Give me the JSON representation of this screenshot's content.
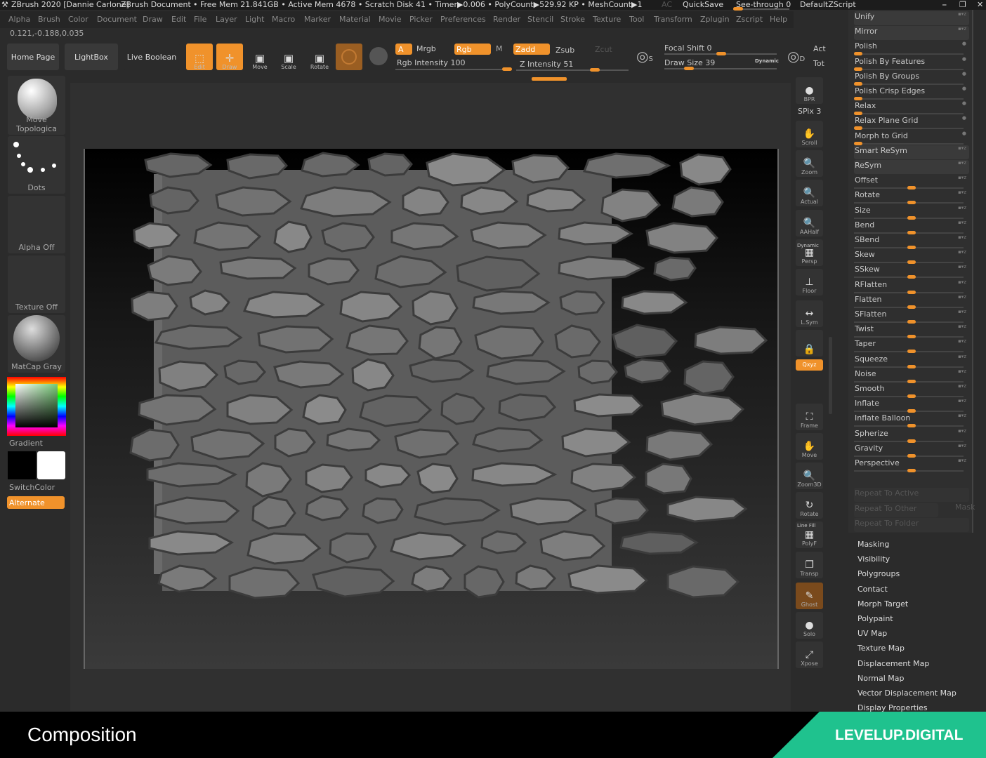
{
  "titlebar": {
    "app": "ZBrush 2020 [Dannie Carlone]",
    "doc": "ZBrush Document",
    "stats": "• Free Mem 21.841GB • Active Mem 4678 • Scratch Disk 41 • Timer▶0.006 • PolyCount▶529.92 KP • MeshCount▶1",
    "ac": "AC",
    "quicksave": "QuickSave",
    "seethrough": "See-through  0",
    "script": "DefaultZScript"
  },
  "menu": [
    "Alpha",
    "Brush",
    "Color",
    "Document",
    "Draw",
    "Edit",
    "File",
    "Layer",
    "Light",
    "Macro",
    "Marker",
    "Material",
    "Movie",
    "Picker",
    "Preferences",
    "Render",
    "Stencil",
    "Stroke",
    "Texture",
    "Tool",
    "Transform",
    "Zplugin",
    "Zscript",
    "Help"
  ],
  "coords": "0.121,-0.188,0.035",
  "toolbar": {
    "home": "Home Page",
    "lightbox": "LightBox",
    "liveboolean": "Live Boolean",
    "edit": "Edit",
    "draw": "Draw",
    "move": "Move",
    "scale": "Scale",
    "rotate": "Rotate",
    "a": "A",
    "mrgb": "Mrgb",
    "rgb": "Rgb",
    "m": "M",
    "zadd": "Zadd",
    "zsub": "Zsub",
    "zcut": "Zcut",
    "rgb_intensity": "Rgb Intensity 100",
    "z_intensity": "Z Intensity 51",
    "focal_shift": "Focal Shift 0",
    "draw_size": "Draw Size 39",
    "dynamic": "Dynamic",
    "act": "Act",
    "tot": "Tot",
    "s": "S",
    "d": "D"
  },
  "left_shelf": {
    "brush": "Move Topologica",
    "stroke": "Dots",
    "alpha": "Alpha Off",
    "texture": "Texture Off",
    "material": "MatCap Gray",
    "gradient": "Gradient",
    "switchcolor": "SwitchColor",
    "alternate": "Alternate"
  },
  "right_shelf": [
    {
      "label": "BPR",
      "icon": "sphere-icon"
    },
    {
      "label": "Scroll",
      "icon": "hand-icon"
    },
    {
      "label": "Zoom",
      "icon": "magnifier-icon"
    },
    {
      "label": "Actual",
      "icon": "magnifier-icon"
    },
    {
      "label": "AAHalf",
      "icon": "magnifier-icon"
    },
    {
      "label": "Persp",
      "icon": "grid-icon"
    },
    {
      "label": "Floor",
      "icon": "floor-icon"
    },
    {
      "label": "L.Sym",
      "icon": "symmetry-icon"
    },
    {
      "label": "",
      "icon": "lock-icon"
    },
    {
      "label": "Qxyz",
      "icon": "axis-icon"
    },
    {
      "label": "Frame",
      "icon": "frame-icon"
    },
    {
      "label": "Move",
      "icon": "hand-icon"
    },
    {
      "label": "Zoom3D",
      "icon": "magnifier-icon"
    },
    {
      "label": "Rotate",
      "icon": "rotate-icon"
    },
    {
      "label": "PolyF",
      "icon": "grid-icon"
    },
    {
      "label": "Transp",
      "icon": "layers-icon"
    },
    {
      "label": "Ghost",
      "icon": "ghost-icon"
    },
    {
      "label": "Solo",
      "icon": "solo-icon"
    },
    {
      "label": "Xpose",
      "icon": "expand-icon"
    }
  ],
  "spix": "SPix 3",
  "persp_dynamic": "Dynamic",
  "linefill": "Line Fill",
  "deformation": [
    {
      "label": "Unify",
      "kind": "box"
    },
    {
      "label": "Mirror",
      "kind": "box"
    },
    {
      "label": "Polish",
      "kind": "small",
      "value": 0
    },
    {
      "label": "Polish By Features",
      "kind": "small",
      "value": 0
    },
    {
      "label": "Polish By Groups",
      "kind": "small",
      "value": 0
    },
    {
      "label": "Polish Crisp Edges",
      "kind": "small",
      "value": 0
    },
    {
      "label": "Relax",
      "kind": "small",
      "value": 0
    },
    {
      "label": "Relax Plane Grid",
      "kind": "small",
      "value": 0
    },
    {
      "label": "Morph to Grid",
      "kind": "small",
      "value": 0
    },
    {
      "label": "Smart ReSym",
      "kind": "box"
    },
    {
      "label": "ReSym",
      "kind": "box"
    },
    {
      "label": "Offset",
      "kind": "mid",
      "value": 0
    },
    {
      "label": "Rotate",
      "kind": "mid",
      "value": 0
    },
    {
      "label": "Size",
      "kind": "mid",
      "value": 0
    },
    {
      "label": "Bend",
      "kind": "mid",
      "value": 0
    },
    {
      "label": "SBend",
      "kind": "mid",
      "value": 0
    },
    {
      "label": "Skew",
      "kind": "mid",
      "value": 0
    },
    {
      "label": "SSkew",
      "kind": "mid",
      "value": 0
    },
    {
      "label": "RFlatten",
      "kind": "mid",
      "value": 0
    },
    {
      "label": "Flatten",
      "kind": "mid",
      "value": 0
    },
    {
      "label": "SFlatten",
      "kind": "mid",
      "value": 0
    },
    {
      "label": "Twist",
      "kind": "mid",
      "value": 0
    },
    {
      "label": "Taper",
      "kind": "mid",
      "value": 0
    },
    {
      "label": "Squeeze",
      "kind": "mid",
      "value": 0
    },
    {
      "label": "Noise",
      "kind": "mid",
      "value": 0
    },
    {
      "label": "Smooth",
      "kind": "mid",
      "value": 0
    },
    {
      "label": "Inflate",
      "kind": "mid",
      "value": 0
    },
    {
      "label": "Inflate Balloon",
      "kind": "mid",
      "value": 0
    },
    {
      "label": "Spherize",
      "kind": "mid",
      "value": 0
    },
    {
      "label": "Gravity",
      "kind": "mid",
      "value": 0
    },
    {
      "label": "Perspective",
      "kind": "mid",
      "value": 0
    }
  ],
  "repeat": [
    "Repeat To Active",
    "Repeat To Other",
    "Repeat To Folder"
  ],
  "mask": "Mask",
  "subpalettes": [
    "Masking",
    "Visibility",
    "Polygroups",
    "Contact",
    "Morph Target",
    "Polypaint",
    "UV Map",
    "Texture Map",
    "Displacement Map",
    "Normal Map",
    "Vector Displacement Map",
    "Display Properties"
  ],
  "banner": {
    "title": "Composition",
    "brand": "LEVELUP.DIGITAL",
    "brand_color": "#1fc28e"
  },
  "colors": {
    "accent": "#f0922b"
  }
}
